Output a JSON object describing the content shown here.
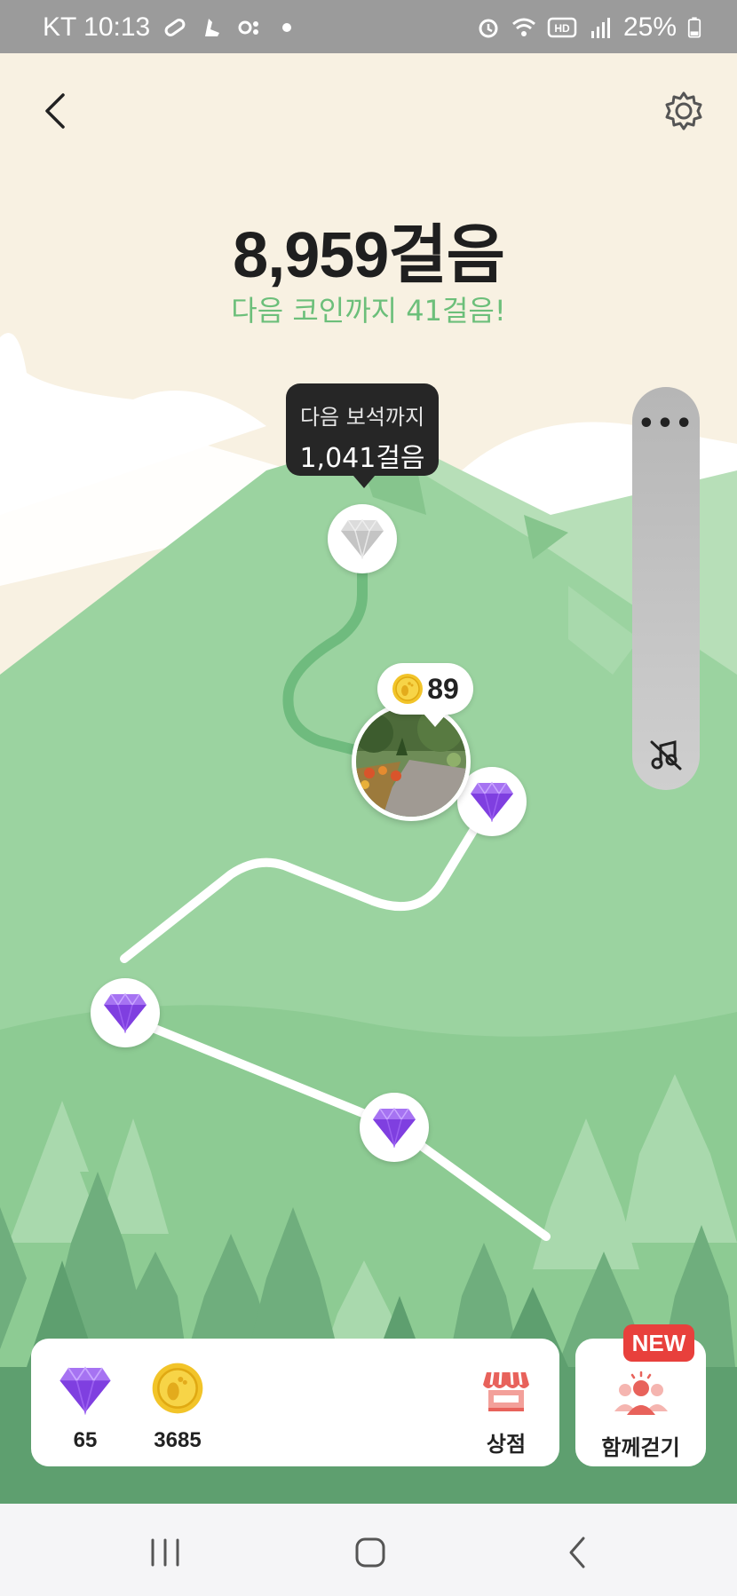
{
  "status_bar": {
    "carrier_time": "KT 10:13",
    "battery": "25%"
  },
  "header": {
    "back_icon": "chevron-left-icon",
    "settings_icon": "gear-icon"
  },
  "steps": {
    "count_text": "8,959걸음",
    "next_coin_text": "다음 코인까지 41걸음!"
  },
  "tooltip": {
    "line1": "다음 보석까지",
    "line2": "1,041걸음"
  },
  "coin_bubble": {
    "value": "89"
  },
  "music_panel": {
    "more_icon": "more-dots-icon",
    "mute_icon": "music-off-icon"
  },
  "wallet": {
    "gems": "65",
    "coins": "3685",
    "shop_label": "상점"
  },
  "walk_together": {
    "badge": "NEW",
    "label": "함께걷기"
  },
  "colors": {
    "accent_green": "#6cbf7a",
    "gem_purple": "#8a4de8",
    "badge_red": "#e8403c"
  }
}
